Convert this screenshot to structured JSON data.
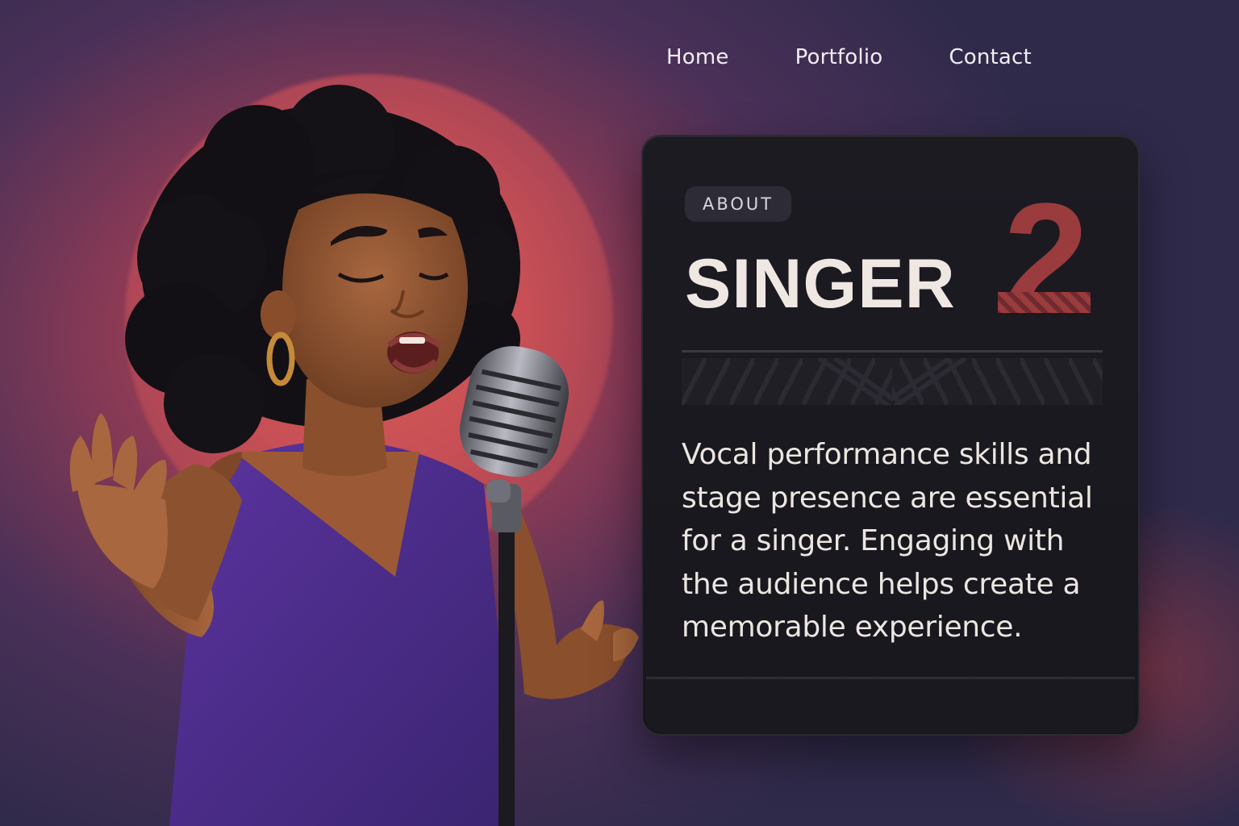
{
  "nav": {
    "items": [
      {
        "label": "Home"
      },
      {
        "label": "Portfolio"
      },
      {
        "label": "Contact"
      }
    ]
  },
  "card": {
    "badge": "ABOUT",
    "title": "SINGER",
    "number": "2",
    "body": "Vocal performance skills and stage presence are essential for a singer. Engaging with the audience helps create a memorable experience."
  },
  "colors": {
    "accent": "#9a3b3e",
    "card_bg": "#1c1b22",
    "text": "#ece6e1",
    "dress": "#4a2a82"
  },
  "illustration": {
    "subject": "singer-illustration",
    "icon": "microphone-icon"
  }
}
